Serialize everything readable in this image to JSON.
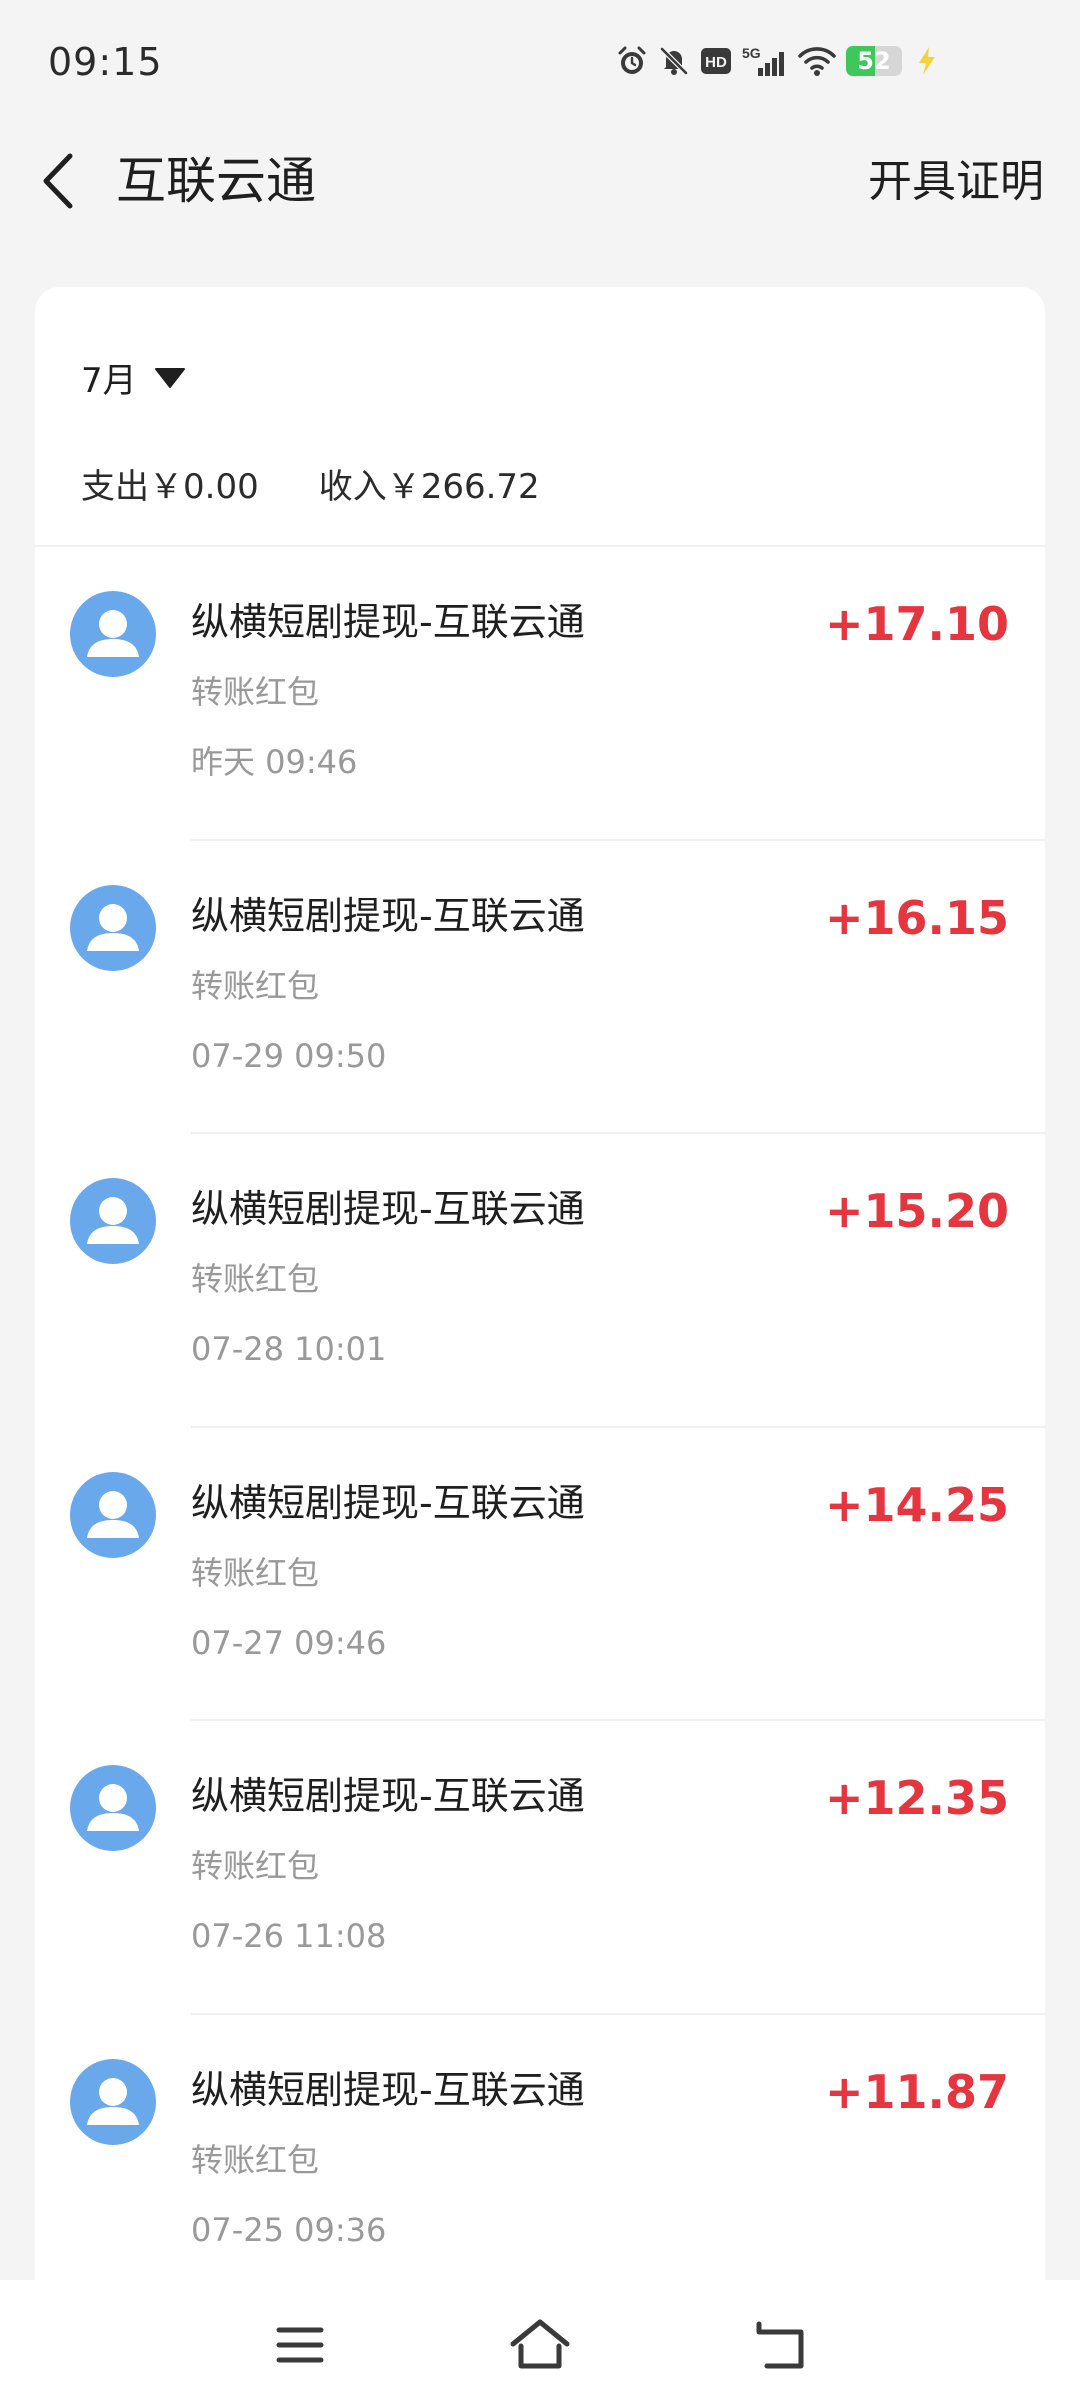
{
  "status_bar": {
    "time": "09:15",
    "network": "5G",
    "hd_label": "HD",
    "battery_level": "52",
    "battery_fraction": 0.52,
    "icons": [
      "alarm-icon",
      "mute-bell-icon",
      "hd-icon",
      "signal-5g-icon",
      "wifi-icon",
      "battery-icon",
      "charging-icon"
    ]
  },
  "header": {
    "title": "互联云通",
    "action_label": "开具证明",
    "back_icon": "chevron-left-icon"
  },
  "filter": {
    "month": "7月",
    "dropdown_icon": "triangle-down-icon"
  },
  "summary": {
    "expense": "支出￥0.00",
    "income": "收入￥266.72"
  },
  "transactions": [
    {
      "title": "纵横短剧提现-互联云通",
      "type": "转账红包",
      "time": "昨天 09:46",
      "amount": "+17.10"
    },
    {
      "title": "纵横短剧提现-互联云通",
      "type": "转账红包",
      "time": "07-29 09:50",
      "amount": "+16.15"
    },
    {
      "title": "纵横短剧提现-互联云通",
      "type": "转账红包",
      "time": "07-28 10:01",
      "amount": "+15.20"
    },
    {
      "title": "纵横短剧提现-互联云通",
      "type": "转账红包",
      "time": "07-27 09:46",
      "amount": "+14.25"
    },
    {
      "title": "纵横短剧提现-互联云通",
      "type": "转账红包",
      "time": "07-26 11:08",
      "amount": "+12.35"
    },
    {
      "title": "纵横短剧提现-互联云通",
      "type": "转账红包",
      "time": "07-25 09:36",
      "amount": "+11.87"
    }
  ],
  "nav": {
    "icons": [
      "menu-icon",
      "home-icon",
      "back-icon"
    ]
  },
  "colors": {
    "background": "#f4f4f5",
    "card": "#ffffff",
    "amount_red": "#e5353e",
    "avatar_blue": "#6aa8ec",
    "battery_green": "#3ec75b",
    "secondary_text": "#999999"
  }
}
